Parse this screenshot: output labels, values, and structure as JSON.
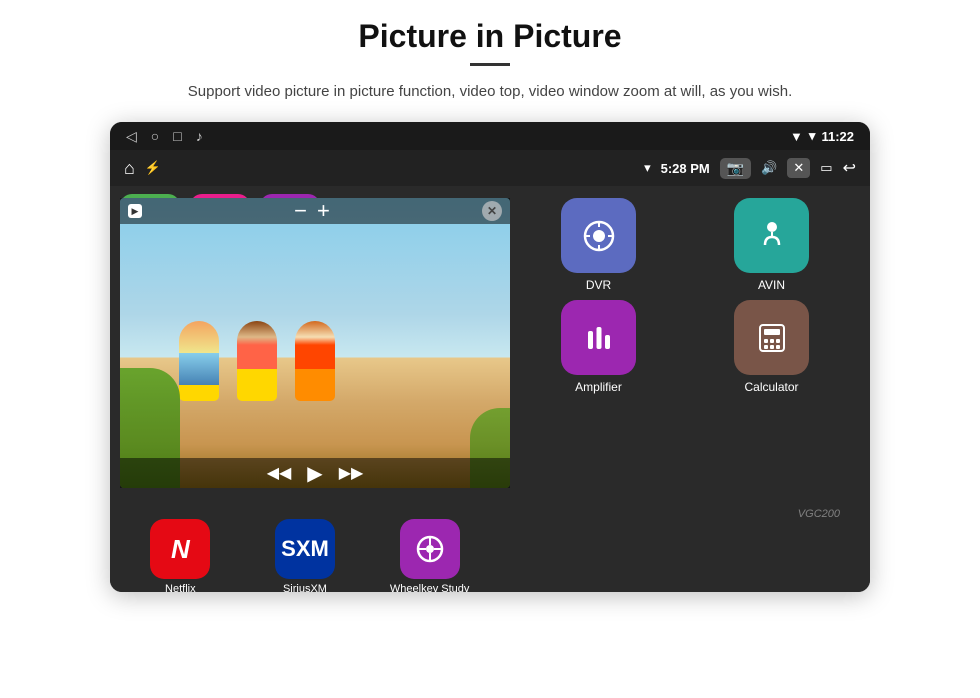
{
  "page": {
    "title": "Picture in Picture",
    "divider": true,
    "subtitle": "Support video picture in picture function, video top, video window zoom at will, as you wish."
  },
  "statusBar": {
    "backIcon": "◁",
    "homeIcon": "○",
    "squareIcon": "□",
    "musicIcon": "♪",
    "locationIcon": "▼",
    "wifiIcon": "▾",
    "time": "11:22"
  },
  "topBar": {
    "homeIcon": "⌂",
    "usbIcon": "⚡",
    "wifiIcon": "▾",
    "time": "5:28 PM",
    "cameraIcon": "📷",
    "soundIcon": "🔊",
    "closeIcon": "✕",
    "windowIcon": "▭",
    "backIcon": "↩"
  },
  "pip": {
    "recordIcon": "▶",
    "minusLabel": "−",
    "plusLabel": "+",
    "closeLabel": "✕",
    "prevIcon": "◀◀",
    "playIcon": "▶",
    "nextIcon": "▶▶"
  },
  "bottomApps": [
    {
      "label": "Netflix",
      "color": "#e50914",
      "icon": "N"
    },
    {
      "label": "SiriusXM",
      "color": "#0033a0",
      "icon": "S"
    },
    {
      "label": "Wheelkey Study",
      "color": "#9c27b0",
      "icon": "W"
    }
  ],
  "gridApps": [
    {
      "label": "DVR",
      "color": "#5c6bc0",
      "icon": "📡"
    },
    {
      "label": "AVIN",
      "color": "#26a69a",
      "icon": "🔌"
    },
    {
      "label": "Amplifier",
      "color": "#9c27b0",
      "icon": "🎚"
    },
    {
      "label": "Calculator",
      "color": "#795548",
      "icon": "🧮"
    }
  ],
  "watermark": "VGC200",
  "partialIconColors": [
    "#4caf50",
    "#e91e8c",
    "#9c27b0"
  ]
}
